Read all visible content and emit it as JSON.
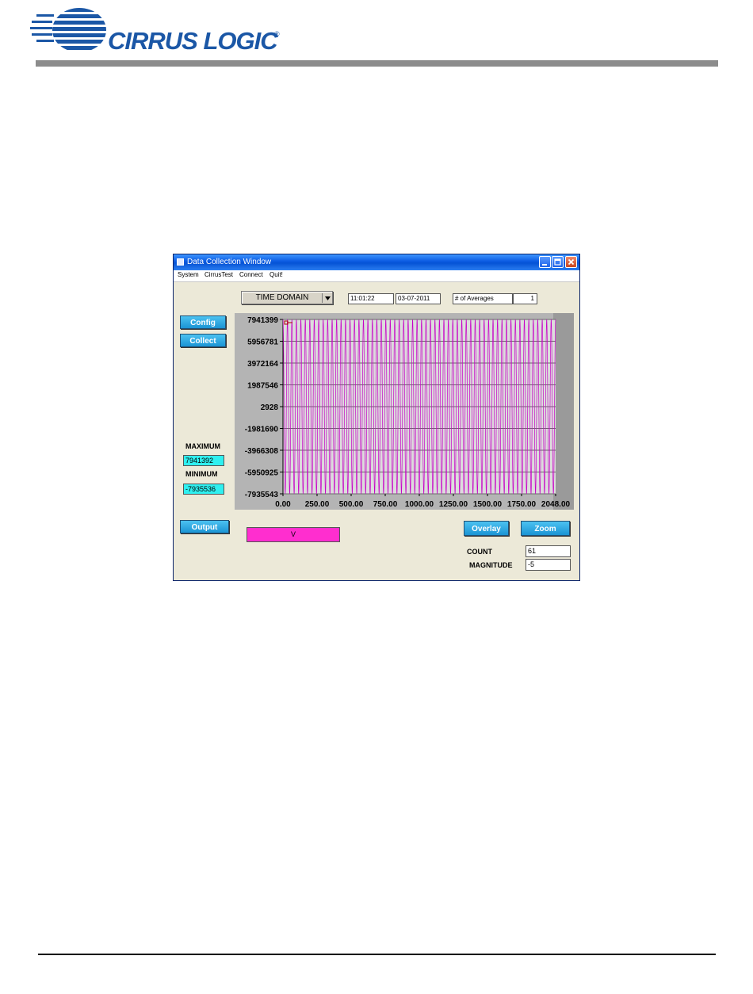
{
  "header": {
    "brand": "CIRRUS LOGIC",
    "registered": "®",
    "brand_color": "#1b57a6"
  },
  "window": {
    "title": "Data Collection Window",
    "menu": [
      "System",
      "CirrusTest",
      "Connect",
      "Quit!"
    ],
    "domain_select": "TIME DOMAIN",
    "time": "11:01:22",
    "date": "03-07-2011",
    "averages_label": "# of Averages",
    "averages_value": "1",
    "buttons": {
      "config": "Config",
      "collect": "Collect",
      "output": "Output",
      "overlay": "Overlay",
      "zoom": "Zoom"
    },
    "maximum_label": "MAXIMUM",
    "maximum_value": "7941392",
    "minimum_label": "MINIMUM",
    "minimum_value": "-7935536",
    "channel_label": "V",
    "count_label": "COUNT",
    "count_value": "61",
    "magnitude_label": "MAGNITUDE",
    "magnitude_value": "-5"
  },
  "colors": {
    "trace": "#c800c8",
    "plot_bg": "#dcdcdc",
    "button": "#1b94d4",
    "readout": "#2ff0f0",
    "channel": "#ff2ecf"
  },
  "chart_data": {
    "type": "line",
    "xlim": [
      0,
      2048
    ],
    "ylim": [
      -7935543,
      7941399
    ],
    "x_ticks": [
      "0.00",
      "250.00",
      "500.00",
      "750.00",
      "1000.00",
      "1250.00",
      "1500.00",
      "1750.00",
      "2048.00"
    ],
    "y_ticks": [
      "7941399",
      "5956781",
      "3972164",
      "1987546",
      "2928",
      "-1981690",
      "-3966308",
      "-5950925",
      "-7935543"
    ],
    "series": [
      {
        "color": "#c800c8",
        "cycles": 61,
        "amplitude_max": 7941392,
        "amplitude_min": -7935536
      }
    ],
    "grid": true
  }
}
